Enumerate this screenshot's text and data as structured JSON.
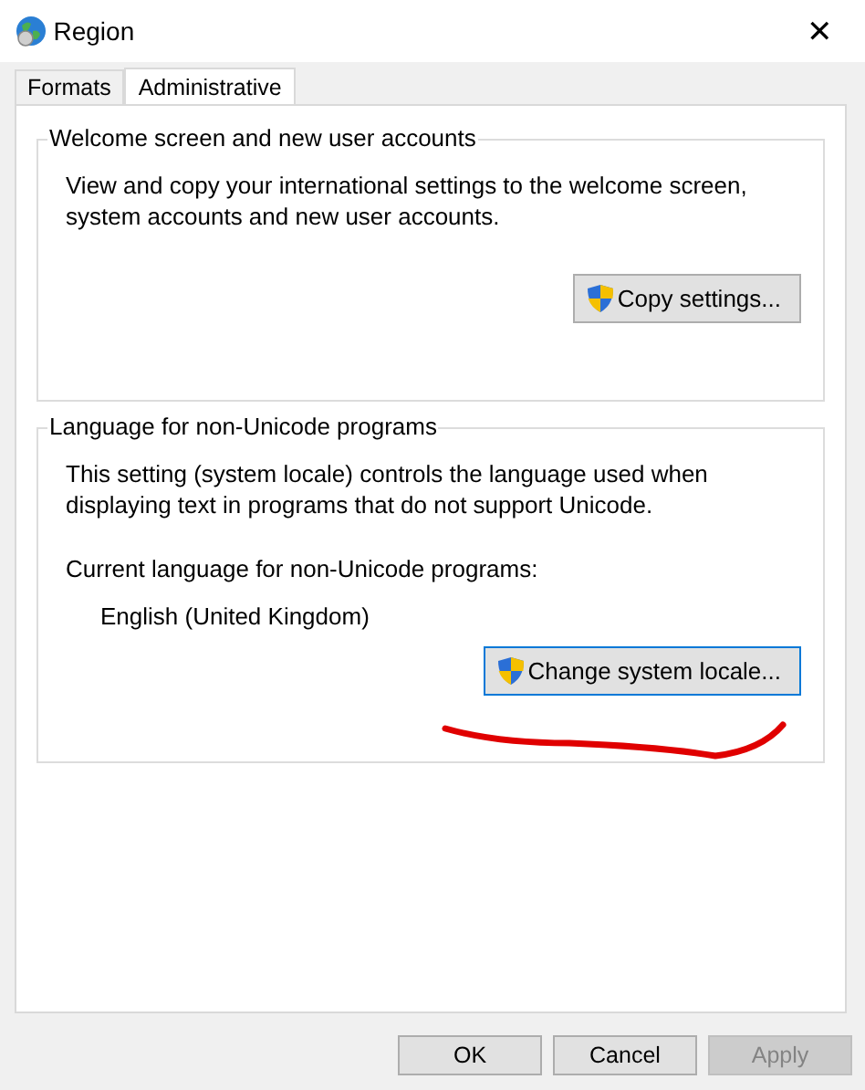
{
  "window": {
    "title": "Region",
    "close": "✕"
  },
  "tabs": [
    {
      "label": "Formats",
      "selected": false
    },
    {
      "label": "Administrative",
      "selected": true
    }
  ],
  "groups": [
    {
      "title": "Welcome screen and new user accounts",
      "text": "View and copy your international settings to the welcome screen, system accounts and new user accounts.",
      "button": "Copy settings..."
    },
    {
      "title": "Language for non-Unicode programs",
      "text": "This setting (system locale) controls the language used when displaying text in programs that do not support Unicode.",
      "current_label": "Current language for non-Unicode programs:",
      "current_value": "English (United Kingdom)",
      "button": "Change system locale..."
    }
  ],
  "buttons": [
    {
      "label": "OK",
      "disabled": false
    },
    {
      "label": "Cancel",
      "disabled": false
    },
    {
      "label": "Apply",
      "disabled": true
    }
  ]
}
